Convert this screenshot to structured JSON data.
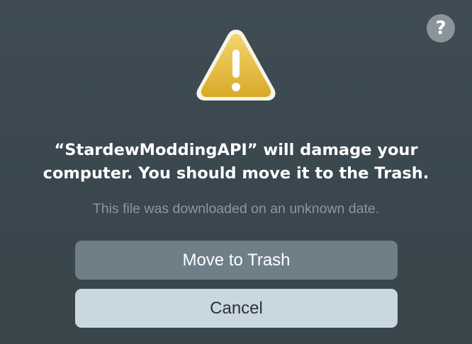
{
  "dialog": {
    "title": "“StardewModdingAPI” will damage your computer. You should move it to the Trash.",
    "title_line1": "“StardewModdingAPI” will damage your",
    "title_line2": "computer. You should move it to the Trash.",
    "info": "This file was downloaded on an unknown date.",
    "icon": "warning-triangle-icon",
    "help_label": "?",
    "buttons": {
      "primary": "Move to Trash",
      "secondary": "Cancel"
    }
  },
  "colors": {
    "background": "#3a4850",
    "warning_yellow": "#e8c04a",
    "primary_button": "#6f7f88",
    "secondary_button": "#c9d8df"
  }
}
